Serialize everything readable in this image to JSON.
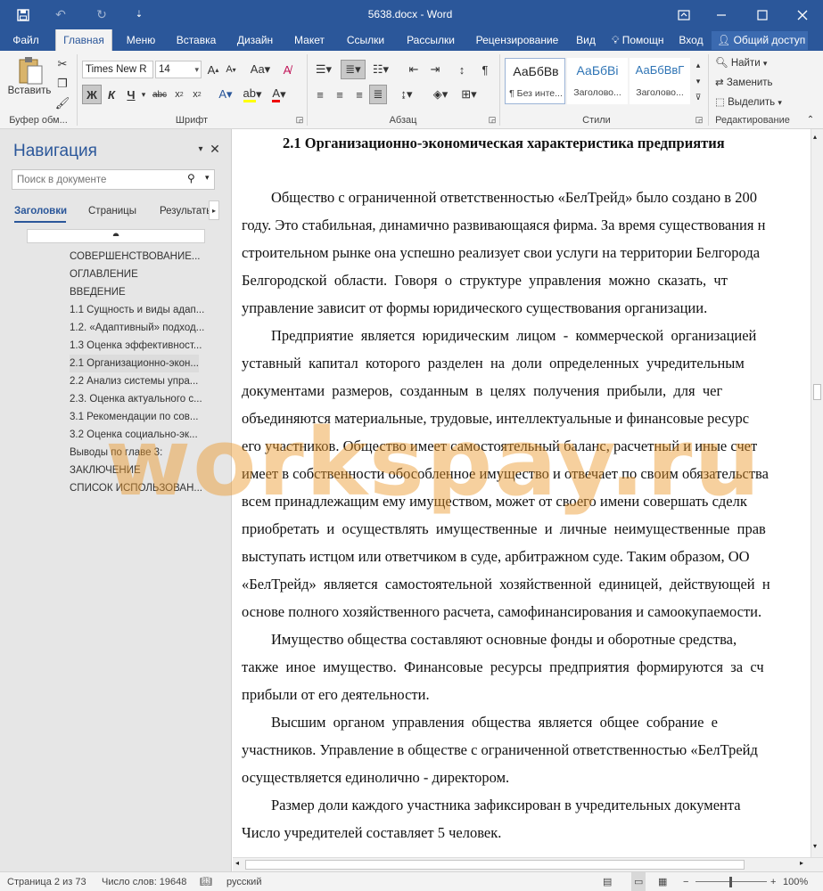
{
  "window": {
    "title": "5638.docx - Word"
  },
  "tabs": [
    "Файл",
    "Главная",
    "Меню",
    "Вставка",
    "Дизайн",
    "Макет",
    "Ссылки",
    "Рассылки",
    "Рецензирование",
    "Вид"
  ],
  "tell_me": "Помощн",
  "sign_in": "Вход",
  "share": "Общий доступ",
  "ribbon": {
    "paste_label": "Вставить",
    "font_name": "Times New R",
    "font_size": "14",
    "groups": {
      "clipboard": "Буфер обм...",
      "font": "Шрифт",
      "paragraph": "Абзац",
      "styles": "Стили",
      "editing": "Редактирование"
    },
    "styles": [
      {
        "sample": "АаБбВв",
        "name": "¶ Без инте..."
      },
      {
        "sample": "АаБбВі",
        "name": "Заголово..."
      },
      {
        "sample": "АаБбВвГ",
        "name": "Заголово..."
      }
    ],
    "editing": {
      "find": "Найти",
      "replace": "Заменить",
      "select": "Выделить"
    },
    "format_buttons": {
      "bold": "Ж",
      "italic": "К",
      "underline": "Ч"
    }
  },
  "nav": {
    "title": "Навигация",
    "search_placeholder": "Поиск в документе",
    "tabs": [
      "Заголовки",
      "Страницы",
      "Результаты"
    ],
    "headings": [
      "СОВЕРШЕНСТВОВАНИЕ...",
      "ОГЛАВЛЕНИЕ",
      "ВВЕДЕНИЕ",
      "1.1 Сущность и виды адап...",
      "1.2. «Адаптивный» подход...",
      "1.3 Оценка эффективност...",
      "2.1 Организационно-экон...",
      "2.2 Анализ системы упра...",
      "2.3. Оценка актуального с...",
      "3.1 Рекомендации по сов...",
      "3.2 Оценка социально-эк...",
      "Выводы по главе 3:",
      "ЗАКЛЮЧЕНИЕ",
      "СПИСОК ИСПОЛЬЗОВАН..."
    ],
    "selected_index": 6
  },
  "document": {
    "heading": "2.1  Организационно-экономическая характеристика предприятия",
    "lines": [
      "        Общество с ограниченной ответственностью «БелТрейд» было создано в 200",
      "году. Это стабильная, динамично развивающаяся фирма. За время существования н",
      "строительном рынке она успешно реализует свои услуги на территории Белгорода",
      "Белгородской  области.  Говоря  о  структуре  управления  можно  сказать,  чт",
      "управление зависит от формы юридического существования организации.",
      "        Предприятие  является  юридическим  лицом  -  коммерческой  организацией",
      "уставный  капитал  которого  разделен  на  доли  определенных  учредительным",
      "документами  размеров,  созданным  в  целях  получения  прибыли,  для  чег",
      "объединяются материальные, трудовые, интеллектуальные и финансовые ресурс",
      "его участников. Общество имеет самостоятельный баланс, расчетный и иные счет",
      "имеет в собственности обособленное имущество и отвечает по своим обязательства",
      "всем принадлежащим ему имуществом, может от своего имени совершать сделк",
      "приобретать  и  осуществлять  имущественные  и  личные  неимущественные  прав",
      "выступать истцом или ответчиком в суде, арбитражном суде. Таким образом, ОО",
      "«БелТрейд»  является  самостоятельной  хозяйственной  единицей,  действующей  н",
      "основе полного хозяйственного расчета, самофинансирования и самоокупаемости.",
      "        Имущество общества составляют основные фонды и оборотные средства, ",
      "также  иное  имущество.  Финансовые  ресурсы  предприятия  формируются  за  сч",
      "прибыли от его деятельности.",
      "        Высшим  органом  управления  общества  является  общее  собрание  е",
      "участников. Управление в обществе с ограниченной ответственностью «БелТрейд",
      "осуществляется единолично - директором.",
      "        Размер доли каждого участника зафиксирован в учредительных документа",
      "Число учредителей составляет 5 человек."
    ]
  },
  "watermark": "workspay.ru",
  "status": {
    "page": "Страница 2 из 73",
    "words": "Число слов: 19648",
    "language": "русский",
    "zoom": "100%"
  },
  "colors": {
    "brand": "#2b579a",
    "watermark": "#ec9628"
  }
}
